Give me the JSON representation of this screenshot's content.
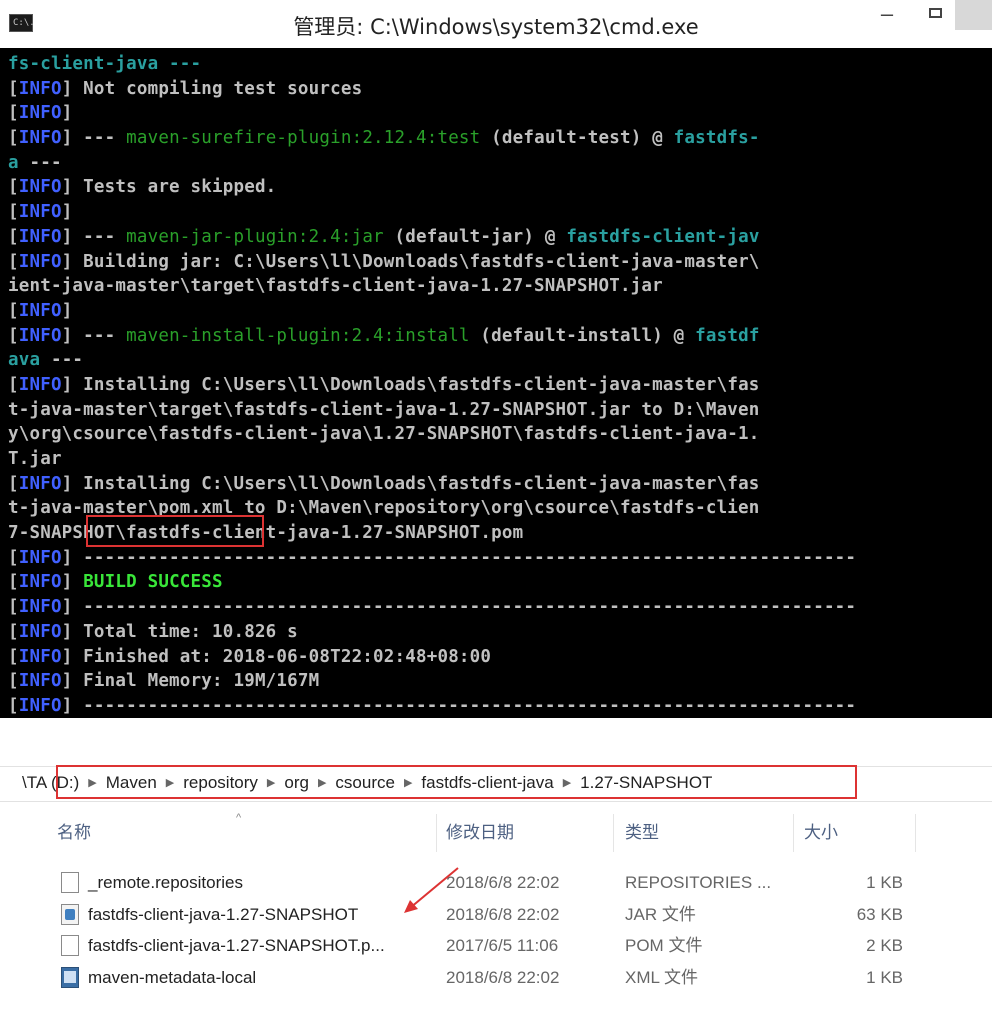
{
  "cmd": {
    "window_title": "管理员: C:\\Windows\\system32\\cmd.exe",
    "icon_text": "C:\\.",
    "lines": [
      {
        "segments": [
          {
            "t": "fs-client-java ---",
            "c": "cyan"
          }
        ]
      },
      {
        "segments": [
          {
            "t": "[",
            "c": "br"
          },
          {
            "t": "INFO",
            "c": "tag-info"
          },
          {
            "t": "] Not compiling test sources",
            "c": "br"
          }
        ]
      },
      {
        "segments": [
          {
            "t": "[",
            "c": "br"
          },
          {
            "t": "INFO",
            "c": "tag-info"
          },
          {
            "t": "]",
            "c": "br"
          }
        ]
      },
      {
        "segments": [
          {
            "t": "[",
            "c": "br"
          },
          {
            "t": "INFO",
            "c": "tag-info"
          },
          {
            "t": "] --- ",
            "c": "br"
          },
          {
            "t": "maven-surefire-plugin:2.12.4:test",
            "c": "plugin"
          },
          {
            "t": " (default-test) @ ",
            "c": "br"
          },
          {
            "t": "fastdfs-",
            "c": "cyan"
          }
        ]
      },
      {
        "segments": [
          {
            "t": "a",
            "c": "cyan"
          },
          {
            "t": " ---",
            "c": "br"
          }
        ]
      },
      {
        "segments": [
          {
            "t": "[",
            "c": "br"
          },
          {
            "t": "INFO",
            "c": "tag-info"
          },
          {
            "t": "] Tests are skipped.",
            "c": "br"
          }
        ]
      },
      {
        "segments": [
          {
            "t": "[",
            "c": "br"
          },
          {
            "t": "INFO",
            "c": "tag-info"
          },
          {
            "t": "]",
            "c": "br"
          }
        ]
      },
      {
        "segments": [
          {
            "t": "[",
            "c": "br"
          },
          {
            "t": "INFO",
            "c": "tag-info"
          },
          {
            "t": "] --- ",
            "c": "br"
          },
          {
            "t": "maven-jar-plugin:2.4:jar",
            "c": "plugin"
          },
          {
            "t": " (default-jar) @ ",
            "c": "br"
          },
          {
            "t": "fastdfs-client-jav",
            "c": "cyan"
          }
        ]
      },
      {
        "segments": [
          {
            "t": "[",
            "c": "br"
          },
          {
            "t": "INFO",
            "c": "tag-info"
          },
          {
            "t": "] Building jar: C:\\Users\\ll\\Downloads\\fastdfs-client-java-master\\",
            "c": "br"
          }
        ]
      },
      {
        "segments": [
          {
            "t": "ient-java-master\\target\\fastdfs-client-java-1.27-SNAPSHOT.jar",
            "c": "br"
          }
        ]
      },
      {
        "segments": [
          {
            "t": "[",
            "c": "br"
          },
          {
            "t": "INFO",
            "c": "tag-info"
          },
          {
            "t": "]",
            "c": "br"
          }
        ]
      },
      {
        "segments": [
          {
            "t": "[",
            "c": "br"
          },
          {
            "t": "INFO",
            "c": "tag-info"
          },
          {
            "t": "] --- ",
            "c": "br"
          },
          {
            "t": "maven-install-plugin:2.4:install",
            "c": "plugin"
          },
          {
            "t": " (default-install) @ ",
            "c": "br"
          },
          {
            "t": "fastdf",
            "c": "cyan"
          }
        ]
      },
      {
        "segments": [
          {
            "t": "ava",
            "c": "cyan"
          },
          {
            "t": " ---",
            "c": "br"
          }
        ]
      },
      {
        "segments": [
          {
            "t": "[",
            "c": "br"
          },
          {
            "t": "INFO",
            "c": "tag-info"
          },
          {
            "t": "] Installing C:\\Users\\ll\\Downloads\\fastdfs-client-java-master\\fas",
            "c": "br"
          }
        ]
      },
      {
        "segments": [
          {
            "t": "t-java-master\\target\\fastdfs-client-java-1.27-SNAPSHOT.jar to D:\\Maven",
            "c": "br"
          }
        ]
      },
      {
        "segments": [
          {
            "t": "y\\org\\csource\\fastdfs-client-java\\1.27-SNAPSHOT\\fastdfs-client-java-1.",
            "c": "br"
          }
        ]
      },
      {
        "segments": [
          {
            "t": "T.jar",
            "c": "br"
          }
        ]
      },
      {
        "segments": [
          {
            "t": "[",
            "c": "br"
          },
          {
            "t": "INFO",
            "c": "tag-info"
          },
          {
            "t": "] Installing C:\\Users\\ll\\Downloads\\fastdfs-client-java-master\\fas",
            "c": "br"
          }
        ]
      },
      {
        "segments": [
          {
            "t": "t-java-master\\pom.xml to D:\\Maven\\repository\\org\\csource\\fastdfs-clien",
            "c": "br"
          }
        ]
      },
      {
        "segments": [
          {
            "t": "7-SNAPSHOT\\fastdfs-client-java-1.27-SNAPSHOT.pom",
            "c": "br"
          }
        ]
      },
      {
        "segments": [
          {
            "t": "[",
            "c": "br"
          },
          {
            "t": "INFO",
            "c": "tag-info"
          },
          {
            "t": "] ------------------------------------------------------------------------",
            "c": "dashes"
          }
        ]
      },
      {
        "segments": [
          {
            "t": "[",
            "c": "br"
          },
          {
            "t": "INFO",
            "c": "tag-info"
          },
          {
            "t": "] ",
            "c": "br"
          },
          {
            "t": "BUILD SUCCESS",
            "c": "success"
          }
        ]
      },
      {
        "segments": [
          {
            "t": "[",
            "c": "br"
          },
          {
            "t": "INFO",
            "c": "tag-info"
          },
          {
            "t": "] ------------------------------------------------------------------------",
            "c": "dashes"
          }
        ]
      },
      {
        "segments": [
          {
            "t": "[",
            "c": "br"
          },
          {
            "t": "INFO",
            "c": "tag-info"
          },
          {
            "t": "] Total time: 10.826 s",
            "c": "br"
          }
        ]
      },
      {
        "segments": [
          {
            "t": "[",
            "c": "br"
          },
          {
            "t": "INFO",
            "c": "tag-info"
          },
          {
            "t": "] Finished at: 2018-06-08T22:02:48+08:00",
            "c": "br"
          }
        ]
      },
      {
        "segments": [
          {
            "t": "[",
            "c": "br"
          },
          {
            "t": "INFO",
            "c": "tag-info"
          },
          {
            "t": "] Final Memory: 19M/167M",
            "c": "br"
          }
        ]
      },
      {
        "segments": [
          {
            "t": "[",
            "c": "br"
          },
          {
            "t": "INFO",
            "c": "tag-info"
          },
          {
            "t": "] ------------------------------------------------------------------------",
            "c": "dashes"
          }
        ]
      }
    ]
  },
  "explorer": {
    "breadcrumb": [
      "\\TA (D:)",
      "Maven",
      "repository",
      "org",
      "csource",
      "fastdfs-client-java",
      "1.27-SNAPSHOT"
    ],
    "breadcrumb_separator": "▶",
    "columns": {
      "name": "名称",
      "date": "修改日期",
      "type": "类型",
      "size": "大小"
    },
    "files": [
      {
        "icon": "file",
        "name": "_remote.repositories",
        "date": "2018/6/8 22:02",
        "type": "REPOSITORIES ...",
        "size": "1 KB"
      },
      {
        "icon": "jar",
        "name": "fastdfs-client-java-1.27-SNAPSHOT",
        "date": "2018/6/8 22:02",
        "type": "JAR 文件",
        "size": "63 KB"
      },
      {
        "icon": "file",
        "name": "fastdfs-client-java-1.27-SNAPSHOT.p...",
        "date": "2017/6/5 11:06",
        "type": "POM 文件",
        "size": "2 KB"
      },
      {
        "icon": "xml",
        "name": "maven-metadata-local",
        "date": "2018/6/8 22:02",
        "type": "XML 文件",
        "size": "1 KB"
      }
    ]
  },
  "colors": {
    "highlight_box": "#dd3333",
    "console_bg": "#000000",
    "info_tag": "#4060ff",
    "success": "#39e639",
    "plugin": "#2aa02a"
  }
}
